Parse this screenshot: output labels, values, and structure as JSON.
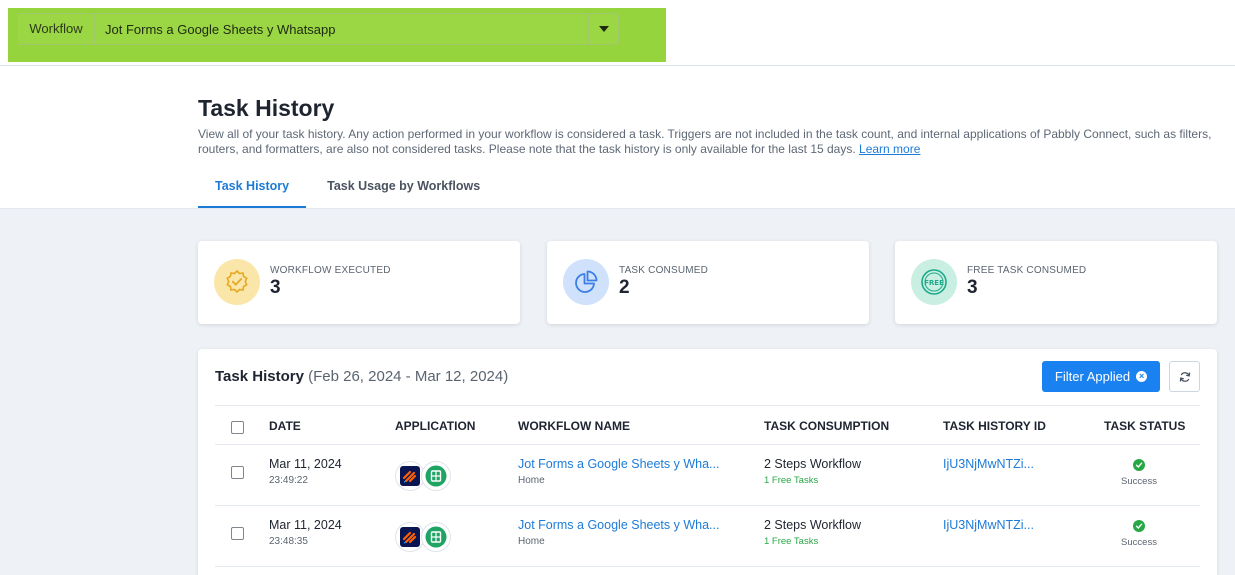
{
  "workflow_bar": {
    "label": "Workflow",
    "selected": "Jot Forms a Google Sheets y Whatsapp"
  },
  "header": {
    "title": "Task History",
    "description": "View all of your task history. Any action performed in your workflow is considered a task. Triggers are not included in the task count, and internal applications of Pabbly Connect, such as filters, routers, and formatters, are also not considered tasks. Please note that the task history is only available for the last 15 days.",
    "learn_more": "Learn more",
    "tabs": [
      {
        "label": "Task History",
        "active": true
      },
      {
        "label": "Task Usage by Workflows",
        "active": false
      }
    ]
  },
  "stats": [
    {
      "label": "WORKFLOW EXECUTED",
      "value": "3",
      "icon": "badge-check-icon",
      "color": "#fbe6a9"
    },
    {
      "label": "TASK CONSUMED",
      "value": "2",
      "icon": "pie-chart-icon",
      "color": "#cfe1fb"
    },
    {
      "label": "FREE TASK CONSUMED",
      "value": "3",
      "icon": "free-badge-icon",
      "color": "#c9efe2"
    }
  ],
  "table": {
    "title": "Task History",
    "range": "(Feb 26, 2024 - Mar 12, 2024)",
    "filter_label": "Filter Applied",
    "columns": [
      "DATE",
      "APPLICATION",
      "WORKFLOW NAME",
      "TASK CONSUMPTION",
      "TASK HISTORY ID",
      "TASK STATUS"
    ],
    "rows": [
      {
        "date": "Mar 11, 2024",
        "time": "23:49:22",
        "workflow": "Jot Forms a Google Sheets y Wha...",
        "folder": "Home",
        "consumption": "2 Steps Workflow",
        "free": "1 Free Tasks",
        "history_id": "IjU3NjMwNTZi...",
        "status": "Success"
      },
      {
        "date": "Mar 11, 2024",
        "time": "23:48:35",
        "workflow": "Jot Forms a Google Sheets y Wha...",
        "folder": "Home",
        "consumption": "2 Steps Workflow",
        "free": "1 Free Tasks",
        "history_id": "IjU3NjMwNTZi...",
        "status": "Success"
      }
    ]
  },
  "colors": {
    "accent": "#1d7bd8",
    "button": "#1a82f0",
    "highlight": "#96d43e",
    "success": "#28a745"
  }
}
